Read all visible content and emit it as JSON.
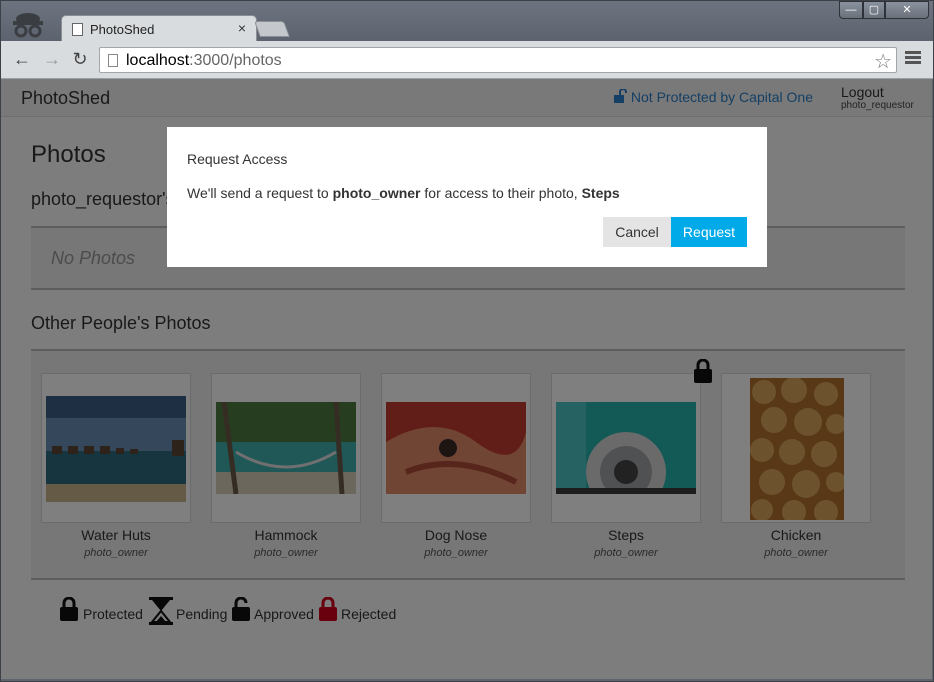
{
  "browser": {
    "tab_title": "PhotoShed",
    "tab_close": "×",
    "url_host": "localhost",
    "url_rest": ":3000/photos",
    "window_controls": [
      "—",
      "▢",
      "✕"
    ]
  },
  "app": {
    "brand": "PhotoShed",
    "protection_status": "Not Protected by Capital One",
    "logout_label": "Logout",
    "current_user": "photo_requestor"
  },
  "main": {
    "title": "Photos",
    "my_photos_heading": "photo_requestor's Photos",
    "no_photos": "No Photos",
    "other_heading": "Other People's Photos",
    "photos": [
      {
        "title": "Water Huts",
        "owner": "photo_owner"
      },
      {
        "title": "Hammock",
        "owner": "photo_owner"
      },
      {
        "title": "Dog Nose",
        "owner": "photo_owner"
      },
      {
        "title": "Steps",
        "owner": "photo_owner",
        "status": "protected"
      },
      {
        "title": "Chicken",
        "owner": "photo_owner"
      }
    ],
    "legend": {
      "protected": "Protected",
      "pending": "Pending",
      "approved": "Approved",
      "rejected": "Rejected"
    }
  },
  "modal": {
    "title": "Request Access",
    "body_prefix": "We'll send a request to ",
    "body_owner": "photo_owner",
    "body_middle": " for access to their photo, ",
    "body_photo": "Steps",
    "cancel_label": "Cancel",
    "request_label": "Request"
  },
  "colors": {
    "accent": "#00a9e8",
    "link": "#2a7fc8",
    "rejected": "#d0021b"
  }
}
